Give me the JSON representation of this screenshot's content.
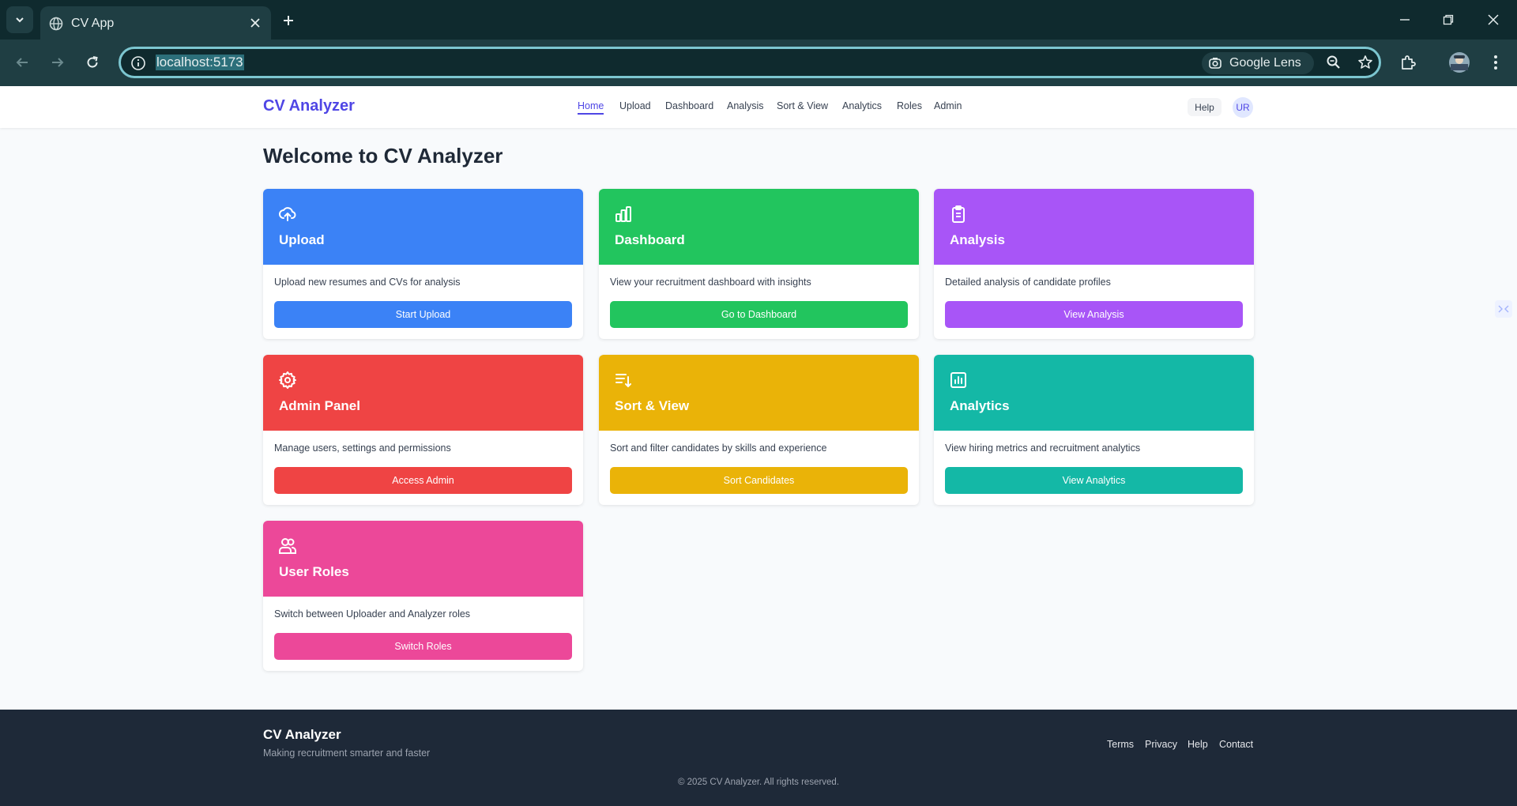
{
  "browser": {
    "tab_title": "CV App",
    "url": "localhost:5173",
    "lens_label": "Google Lens"
  },
  "header": {
    "brand": "CV Analyzer",
    "nav": [
      "Home",
      "Upload",
      "Dashboard",
      "Analysis",
      "Sort & View",
      "Analytics",
      "Roles",
      "Admin"
    ],
    "active_nav": "Home",
    "help": "Help",
    "avatar": "UR"
  },
  "main": {
    "title": "Welcome to CV Analyzer",
    "cards": [
      {
        "title": "Upload",
        "desc": "Upload new resumes and CVs for analysis",
        "button": "Start Upload",
        "color": "#3b82f6",
        "icon": "upload-cloud-icon"
      },
      {
        "title": "Dashboard",
        "desc": "View your recruitment dashboard with insights",
        "button": "Go to Dashboard",
        "color": "#22c55e",
        "icon": "bar-chart-icon"
      },
      {
        "title": "Analysis",
        "desc": "Detailed analysis of candidate profiles",
        "button": "View Analysis",
        "color": "#a855f7",
        "icon": "clipboard-icon"
      },
      {
        "title": "Admin Panel",
        "desc": "Manage users, settings and permissions",
        "button": "Access Admin",
        "color": "#ef4444",
        "icon": "gear-icon"
      },
      {
        "title": "Sort & View",
        "desc": "Sort and filter candidates by skills and experience",
        "button": "Sort Candidates",
        "color": "#eab308",
        "icon": "sort-list-icon"
      },
      {
        "title": "Analytics",
        "desc": "View hiring metrics and recruitment analytics",
        "button": "View Analytics",
        "color": "#14b8a6",
        "icon": "analytics-chart-icon"
      },
      {
        "title": "User Roles",
        "desc": "Switch between Uploader and Analyzer roles",
        "button": "Switch Roles",
        "color": "#ec4899",
        "icon": "users-icon"
      }
    ]
  },
  "footer": {
    "brand": "CV Analyzer",
    "tagline": "Making recruitment smarter and faster",
    "links": [
      "Terms",
      "Privacy",
      "Help",
      "Contact"
    ],
    "copyright": "© 2025 CV Analyzer. All rights reserved."
  }
}
